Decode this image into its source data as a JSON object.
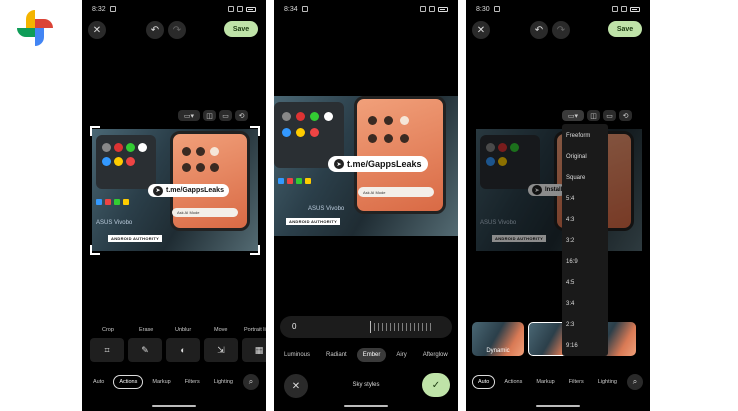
{
  "colors": {
    "accent": "#bfe3a8",
    "phone_bg": "#000000",
    "page_bg": "#ffffff"
  },
  "logo": {
    "icon": "google-photos-logo"
  },
  "screens": [
    {
      "time": "8:32",
      "save_label": "Save",
      "watermark": "t.me/GappsLeaks",
      "brand_badge": "ANDROID AUTHORITY",
      "laptop_text": "ASUS Vivobo",
      "search_text": "Ask AI Mode",
      "tool_labels": [
        "Crop",
        "Erase",
        "Unblur",
        "Move",
        "Portrait li"
      ],
      "tabs": [
        "Auto",
        "Actions",
        "Markup",
        "Filters",
        "Lighting"
      ],
      "selected_tab": "Actions"
    },
    {
      "time": "8:34",
      "watermark": "t.me/GappsLeaks",
      "brand_badge": "ANDROID AUTHORITY",
      "laptop_text": "ASUS Vivobo",
      "search_text": "Ask AI Mode",
      "slider_value": "0",
      "styles": [
        "Luminous",
        "Radiant",
        "Ember",
        "Airy",
        "Afterglow"
      ],
      "selected_style": "Ember",
      "title": "Sky styles"
    },
    {
      "time": "8:30",
      "save_label": "Save",
      "watermark": "Install",
      "brand_badge": "ANDROID AUTHORITY",
      "laptop_text": "ASUS Vivobo",
      "aspect_options": [
        "Freeform",
        "Original",
        "Square",
        "5:4",
        "4:3",
        "3:2",
        "16:9",
        "4:5",
        "3:4",
        "2:3",
        "9:16"
      ],
      "thumb_label": "Dynamic",
      "tabs": [
        "Auto",
        "Actions",
        "Markup",
        "Filters",
        "Lighting"
      ],
      "selected_tab": "Auto"
    }
  ]
}
